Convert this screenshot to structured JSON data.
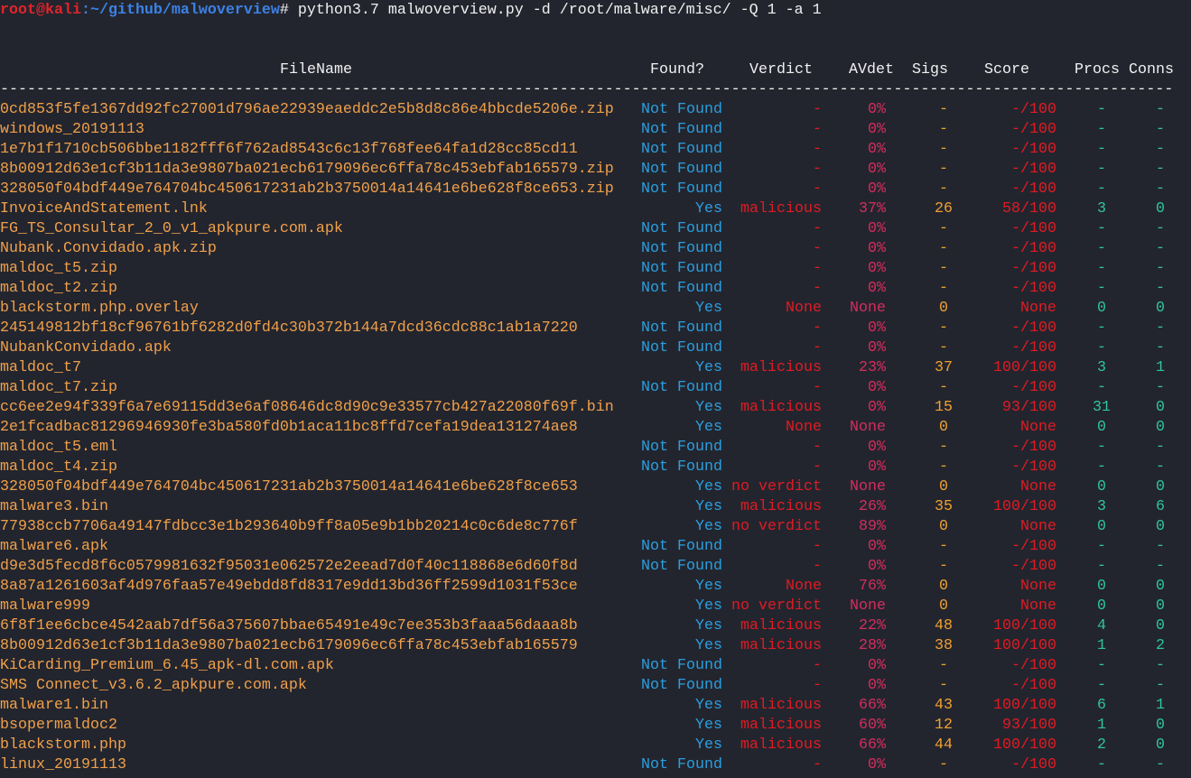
{
  "prompt": {
    "user_host": "root@kali",
    "path": ":~/github/malwoverview",
    "symbol": "#",
    "command": " python3.7 malwoverview.py -d /root/malware/misc/ -Q 1 -a 1"
  },
  "colors": {
    "background": "#23252e",
    "filename": "#f0a04a",
    "found": "#2a9fe0",
    "verdict": "#e01b24",
    "avdet": "#d42d5e",
    "sigs": "#f0a030",
    "score": "#e01b24",
    "procs_conns": "#2ec4a0"
  },
  "headers": {
    "filename": "FileName",
    "found": "Found?",
    "verdict": "Verdict",
    "avdet": "AVdet",
    "sigs": "Sigs",
    "score": "Score",
    "procs": "Procs",
    "conns": "Conns"
  },
  "separator": "------------------------------------------------------------------------------------------------------------------------------------",
  "rows": [
    {
      "file": "0cd853f5fe1367dd92fc27001d796ae22939eaeddc2e5b8d8c86e4bbcde5206e.zip",
      "found": "Not Found",
      "verdict": "-",
      "avdet": "0%",
      "sigs": "-",
      "score": "-/100",
      "procs": "-",
      "conns": "-"
    },
    {
      "file": "windows_20191113",
      "found": "Not Found",
      "verdict": "-",
      "avdet": "0%",
      "sigs": "-",
      "score": "-/100",
      "procs": "-",
      "conns": "-"
    },
    {
      "file": "1e7b1f1710cb506bbe1182fff6f762ad8543c6c13f768fee64fa1d28cc85cd11",
      "found": "Not Found",
      "verdict": "-",
      "avdet": "0%",
      "sigs": "-",
      "score": "-/100",
      "procs": "-",
      "conns": "-"
    },
    {
      "file": "8b00912d63e1cf3b11da3e9807ba021ecb6179096ec6ffa78c453ebfab165579.zip",
      "found": "Not Found",
      "verdict": "-",
      "avdet": "0%",
      "sigs": "-",
      "score": "-/100",
      "procs": "-",
      "conns": "-"
    },
    {
      "file": "328050f04bdf449e764704bc450617231ab2b3750014a14641e6be628f8ce653.zip",
      "found": "Not Found",
      "verdict": "-",
      "avdet": "0%",
      "sigs": "-",
      "score": "-/100",
      "procs": "-",
      "conns": "-"
    },
    {
      "file": "InvoiceAndStatement.lnk",
      "found": "Yes",
      "verdict": "malicious",
      "avdet": "37%",
      "sigs": "26",
      "score": "58/100",
      "procs": "3",
      "conns": "0"
    },
    {
      "file": "FG_TS_Consultar_2_0_v1_apkpure.com.apk",
      "found": "Not Found",
      "verdict": "-",
      "avdet": "0%",
      "sigs": "-",
      "score": "-/100",
      "procs": "-",
      "conns": "-"
    },
    {
      "file": "Nubank.Convidado.apk.zip",
      "found": "Not Found",
      "verdict": "-",
      "avdet": "0%",
      "sigs": "-",
      "score": "-/100",
      "procs": "-",
      "conns": "-"
    },
    {
      "file": "maldoc_t5.zip",
      "found": "Not Found",
      "verdict": "-",
      "avdet": "0%",
      "sigs": "-",
      "score": "-/100",
      "procs": "-",
      "conns": "-"
    },
    {
      "file": "maldoc_t2.zip",
      "found": "Not Found",
      "verdict": "-",
      "avdet": "0%",
      "sigs": "-",
      "score": "-/100",
      "procs": "-",
      "conns": "-"
    },
    {
      "file": "blackstorm.php.overlay",
      "found": "Yes",
      "verdict": "None",
      "avdet": "None",
      "sigs": "0",
      "score": "None",
      "procs": "0",
      "conns": "0"
    },
    {
      "file": "245149812bf18cf96761bf6282d0fd4c30b372b144a7dcd36cdc88c1ab1a7220",
      "found": "Not Found",
      "verdict": "-",
      "avdet": "0%",
      "sigs": "-",
      "score": "-/100",
      "procs": "-",
      "conns": "-"
    },
    {
      "file": "NubankConvidado.apk",
      "found": "Not Found",
      "verdict": "-",
      "avdet": "0%",
      "sigs": "-",
      "score": "-/100",
      "procs": "-",
      "conns": "-"
    },
    {
      "file": "maldoc_t7",
      "found": "Yes",
      "verdict": "malicious",
      "avdet": "23%",
      "sigs": "37",
      "score": "100/100",
      "procs": "3",
      "conns": "1"
    },
    {
      "file": "maldoc_t7.zip",
      "found": "Not Found",
      "verdict": "-",
      "avdet": "0%",
      "sigs": "-",
      "score": "-/100",
      "procs": "-",
      "conns": "-"
    },
    {
      "file": "cc6ee2e94f339f6a7e69115dd3e6af08646dc8d90c9e33577cb427a22080f69f.bin",
      "found": "Yes",
      "verdict": "malicious",
      "avdet": "0%",
      "sigs": "15",
      "score": "93/100",
      "procs": "31",
      "conns": "0"
    },
    {
      "file": "2e1fcadbac81296946930fe3ba580fd0b1aca11bc8ffd7cefa19dea131274ae8",
      "found": "Yes",
      "verdict": "None",
      "avdet": "None",
      "sigs": "0",
      "score": "None",
      "procs": "0",
      "conns": "0"
    },
    {
      "file": "maldoc_t5.eml",
      "found": "Not Found",
      "verdict": "-",
      "avdet": "0%",
      "sigs": "-",
      "score": "-/100",
      "procs": "-",
      "conns": "-"
    },
    {
      "file": "maldoc_t4.zip",
      "found": "Not Found",
      "verdict": "-",
      "avdet": "0%",
      "sigs": "-",
      "score": "-/100",
      "procs": "-",
      "conns": "-"
    },
    {
      "file": "328050f04bdf449e764704bc450617231ab2b3750014a14641e6be628f8ce653",
      "found": "Yes",
      "verdict": "no verdict",
      "avdet": "None",
      "sigs": "0",
      "score": "None",
      "procs": "0",
      "conns": "0"
    },
    {
      "file": "malware3.bin",
      "found": "Yes",
      "verdict": "malicious",
      "avdet": "26%",
      "sigs": "35",
      "score": "100/100",
      "procs": "3",
      "conns": "6"
    },
    {
      "file": "77938ccb7706a49147fdbcc3e1b293640b9ff8a05e9b1bb20214c0c6de8c776f",
      "found": "Yes",
      "verdict": "no verdict",
      "avdet": "89%",
      "sigs": "0",
      "score": "None",
      "procs": "0",
      "conns": "0"
    },
    {
      "file": "malware6.apk",
      "found": "Not Found",
      "verdict": "-",
      "avdet": "0%",
      "sigs": "-",
      "score": "-/100",
      "procs": "-",
      "conns": "-"
    },
    {
      "file": "d9e3d5fecd8f6c0579981632f95031e062572e2eead7d0f40c118868e6d60f8d",
      "found": "Not Found",
      "verdict": "-",
      "avdet": "0%",
      "sigs": "-",
      "score": "-/100",
      "procs": "-",
      "conns": "-"
    },
    {
      "file": "8a87a1261603af4d976faa57e49ebdd8fd8317e9dd13bd36ff2599d1031f53ce",
      "found": "Yes",
      "verdict": "None",
      "avdet": "76%",
      "sigs": "0",
      "score": "None",
      "procs": "0",
      "conns": "0"
    },
    {
      "file": "malware999",
      "found": "Yes",
      "verdict": "no verdict",
      "avdet": "None",
      "sigs": "0",
      "score": "None",
      "procs": "0",
      "conns": "0"
    },
    {
      "file": "6f8f1ee6cbce4542aab7df56a375607bbae65491e49c7ee353b3faaa56daaa8b",
      "found": "Yes",
      "verdict": "malicious",
      "avdet": "22%",
      "sigs": "48",
      "score": "100/100",
      "procs": "4",
      "conns": "0"
    },
    {
      "file": "8b00912d63e1cf3b11da3e9807ba021ecb6179096ec6ffa78c453ebfab165579",
      "found": "Yes",
      "verdict": "malicious",
      "avdet": "28%",
      "sigs": "38",
      "score": "100/100",
      "procs": "1",
      "conns": "2"
    },
    {
      "file": "KiCarding_Premium_6.45_apk-dl.com.apk",
      "found": "Not Found",
      "verdict": "-",
      "avdet": "0%",
      "sigs": "-",
      "score": "-/100",
      "procs": "-",
      "conns": "-"
    },
    {
      "file": "SMS Connect_v3.6.2_apkpure.com.apk",
      "found": "Not Found",
      "verdict": "-",
      "avdet": "0%",
      "sigs": "-",
      "score": "-/100",
      "procs": "-",
      "conns": "-"
    },
    {
      "file": "malware1.bin",
      "found": "Yes",
      "verdict": "malicious",
      "avdet": "66%",
      "sigs": "43",
      "score": "100/100",
      "procs": "6",
      "conns": "1"
    },
    {
      "file": "bsopermaldoc2",
      "found": "Yes",
      "verdict": "malicious",
      "avdet": "60%",
      "sigs": "12",
      "score": "93/100",
      "procs": "1",
      "conns": "0"
    },
    {
      "file": "blackstorm.php",
      "found": "Yes",
      "verdict": "malicious",
      "avdet": "66%",
      "sigs": "44",
      "score": "100/100",
      "procs": "2",
      "conns": "0"
    },
    {
      "file": "linux_20191113",
      "found": "Not Found",
      "verdict": "-",
      "avdet": "0%",
      "sigs": "-",
      "score": "-/100",
      "procs": "-",
      "conns": "-"
    }
  ]
}
